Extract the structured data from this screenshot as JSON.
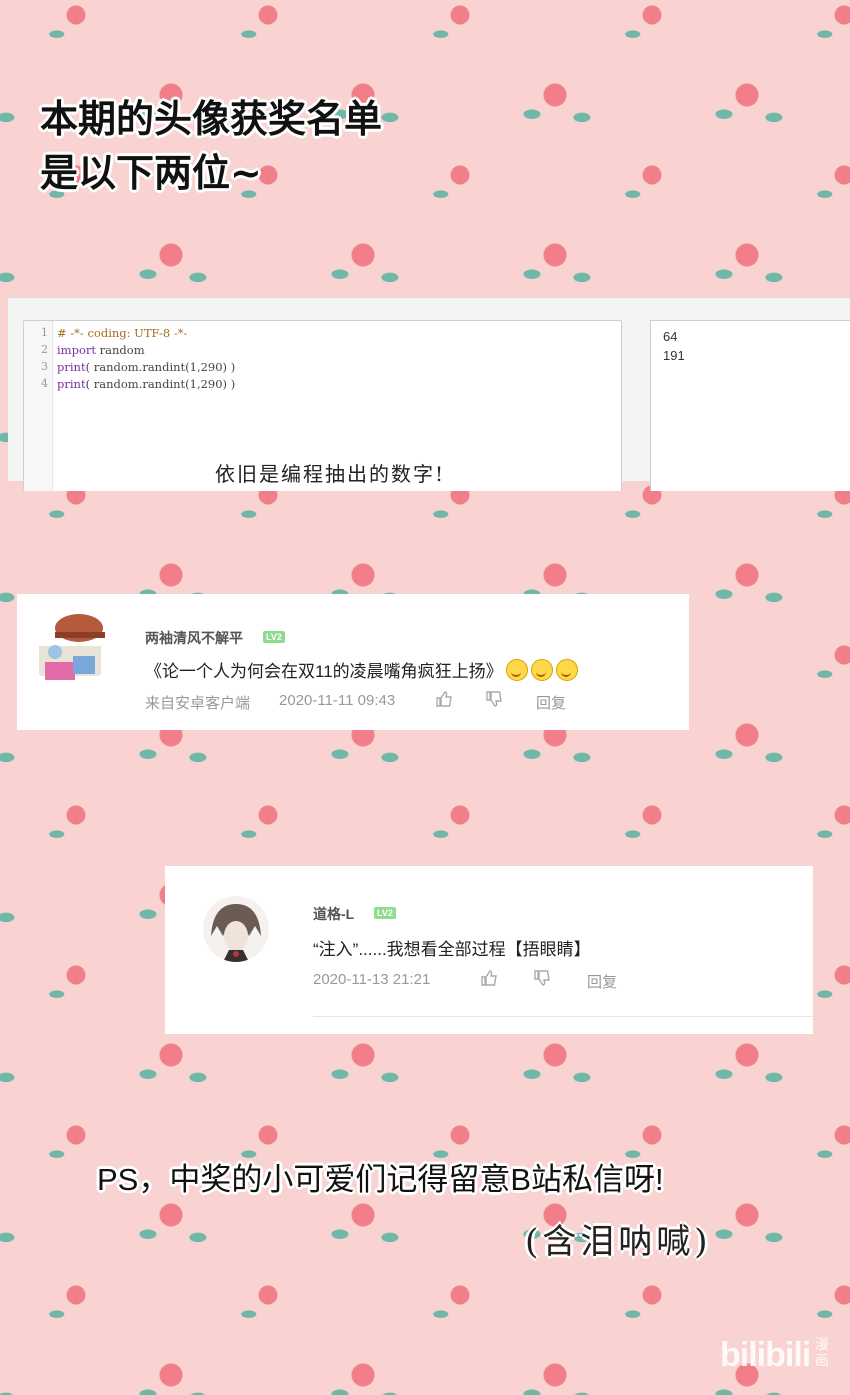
{
  "title": {
    "line1": "本期的头像获奖名单",
    "line2": "是以下两位~"
  },
  "code": {
    "lines": [
      {
        "no": "1",
        "text": "# -*- coding: UTF-8 -*-"
      },
      {
        "no": "2",
        "kw": "import",
        "text": " random"
      },
      {
        "no": "3",
        "kw": "print",
        "text": "( random.randint(1,290) )"
      },
      {
        "no": "4",
        "kw": "print",
        "text": "( random.randint(1,290) )"
      }
    ],
    "output": [
      "64",
      "191"
    ]
  },
  "handnote": "依旧是编程抽出的数字!",
  "comments": [
    {
      "username": "两袖清风不解平",
      "level": "LV2",
      "text": "《论一个人为何会在双11的凌晨嘴角疯狂上扬》",
      "emoji_count": 3,
      "source": "来自安卓客户端",
      "time": "2020-11-11 09:43",
      "reply": "回复"
    },
    {
      "username": "道格-L",
      "level": "LV2",
      "text": "“注入”......我想看全部过程【捂眼睛】",
      "time": "2020-11-13 21:21",
      "reply": "回复"
    }
  ],
  "ps": "PS，中奖的小可爱们记得留意B站私信呀!",
  "cry": "(含泪呐喊)",
  "watermark": {
    "logo": "bilibili",
    "sub": "漫画"
  },
  "colors": {
    "background": "#f9d3d1",
    "rose": "#f07f8a",
    "leaf": "#6fb7a8",
    "level_badge": "#8fdc8f"
  }
}
